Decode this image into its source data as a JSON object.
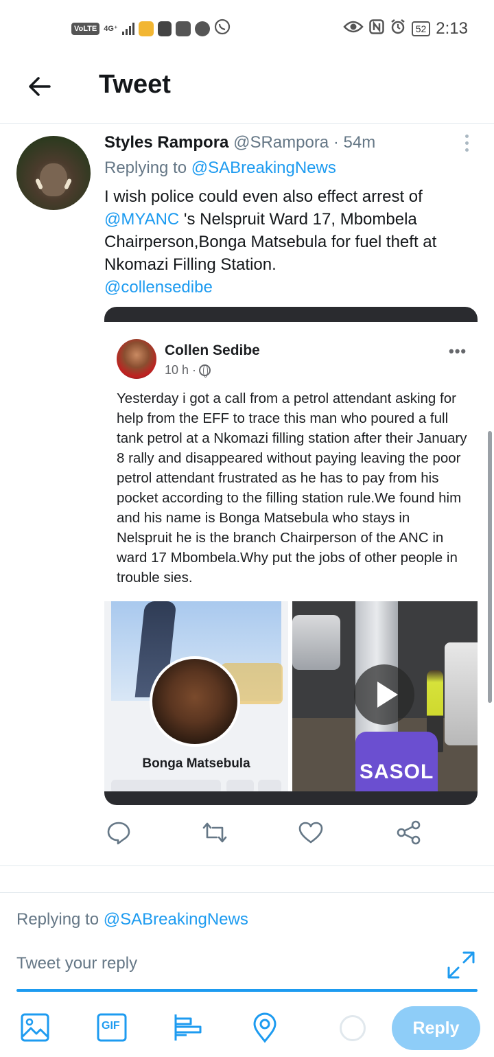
{
  "status_bar": {
    "volte": "VoLTE",
    "network": "4G⁺",
    "battery": "52",
    "time": "2:13"
  },
  "header": {
    "title": "Tweet"
  },
  "tweet": {
    "name": "Styles Rampora",
    "handle": "@SRampora",
    "dot": "·",
    "time": "54m",
    "replying_prefix": "Replying to ",
    "replying_to": "@SABreakingNews",
    "text_part1": "I wish police could even also effect arrest of ",
    "mention1": "@MYANC",
    "text_part2": " 's Nelspruit Ward 17, Mbombela Chairperson,Bonga Matsebula for fuel theft at Nkomazi Filling Station.",
    "mention2": "@collensedibe"
  },
  "embedded_post": {
    "author": "Collen Sedibe",
    "time": "10 h ·",
    "more": "•••",
    "text": "Yesterday i got a call from a petrol attendant asking for help from the EFF to trace this man who poured a full tank petrol at a Nkomazi filling station after their January 8 rally and disappeared without paying leaving the poor petrol attendant frustrated as he has to pay from his pocket according to the filling station rule.We found him and his name is Bonga Matsebula who stays in Nelspruit he is the branch Chairperson of the ANC in ward 17 Mbombela.Why put the jobs of other people in trouble sies.",
    "profile_name": "Bonga Matsebula",
    "pump_brand": "SASOL"
  },
  "composer": {
    "replying_prefix": "Replying to ",
    "replying_to": "@SABreakingNews",
    "placeholder": "Tweet your reply",
    "reply_label": "Reply",
    "gif_label": "GIF"
  },
  "colors": {
    "accent": "#1d9bf0",
    "reply_button": "#8ecdf8",
    "muted": "#657786"
  }
}
